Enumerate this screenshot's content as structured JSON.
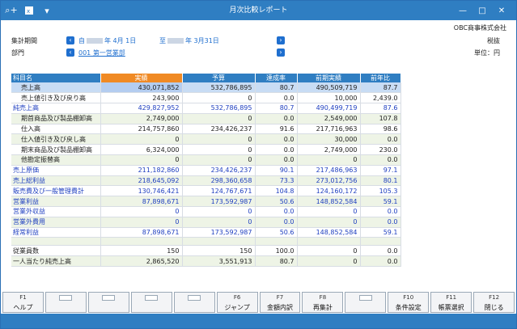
{
  "window": {
    "title": "月次比較レポート",
    "company": "OBC商事株式会社"
  },
  "head": {
    "period_label": "集計期間",
    "period_from_prefix": "自",
    "period_from_suffix": "年 4月 1日",
    "period_to_prefix": "至",
    "period_to_suffix": "年 3月31日",
    "dept_label": "部門",
    "dept_value": "001 第一営業部",
    "tax_label": "税抜",
    "unit_label": "単位：円"
  },
  "table": {
    "headers": [
      "科目名",
      "実績",
      "予算",
      "達成率",
      "前期実績",
      "前年比"
    ],
    "rows": [
      {
        "name": "売上高",
        "v": [
          "430,071,852",
          "532,786,895",
          "80.7",
          "490,509,719",
          "87.7"
        ],
        "indent": true,
        "style": "sel"
      },
      {
        "name": "売上値引き及び戻り高",
        "v": [
          "243,900",
          "0",
          "0.0",
          "10,000",
          "2,439.0"
        ],
        "indent": true,
        "style": ""
      },
      {
        "name": "純売上高",
        "v": [
          "429,827,952",
          "532,786,895",
          "80.7",
          "490,499,719",
          "87.6"
        ],
        "indent": false,
        "style": "blue"
      },
      {
        "name": "期首商品及び製品棚卸高",
        "v": [
          "2,749,000",
          "0",
          "0.0",
          "2,549,000",
          "107.8"
        ],
        "indent": true,
        "style": "alt"
      },
      {
        "name": "仕入高",
        "v": [
          "214,757,860",
          "234,426,237",
          "91.6",
          "217,716,963",
          "98.6"
        ],
        "indent": true,
        "style": ""
      },
      {
        "name": "仕入値引き及び戻し高",
        "v": [
          "0",
          "0",
          "0.0",
          "30,000",
          "0.0"
        ],
        "indent": true,
        "style": "alt"
      },
      {
        "name": "期末商品及び製品棚卸高",
        "v": [
          "6,324,000",
          "0",
          "0.0",
          "2,749,000",
          "230.0"
        ],
        "indent": true,
        "style": ""
      },
      {
        "name": "他勘定振替高",
        "v": [
          "0",
          "0",
          "0.0",
          "0",
          "0.0"
        ],
        "indent": true,
        "style": "alt"
      },
      {
        "name": "売上原価",
        "v": [
          "211,182,860",
          "234,426,237",
          "90.1",
          "217,486,963",
          "97.1"
        ],
        "indent": false,
        "style": "blue"
      },
      {
        "name": "売上総利益",
        "v": [
          "218,645,092",
          "298,360,658",
          "73.3",
          "273,012,756",
          "80.1"
        ],
        "indent": false,
        "style": "blue alt"
      },
      {
        "name": "販売費及び一般管理費計",
        "v": [
          "130,746,421",
          "124,767,671",
          "104.8",
          "124,160,172",
          "105.3"
        ],
        "indent": false,
        "style": "blue"
      },
      {
        "name": "営業利益",
        "v": [
          "87,898,671",
          "173,592,987",
          "50.6",
          "148,852,584",
          "59.1"
        ],
        "indent": false,
        "style": "blue alt"
      },
      {
        "name": "営業外収益",
        "v": [
          "0",
          "0",
          "0.0",
          "0",
          "0.0"
        ],
        "indent": false,
        "style": "blue"
      },
      {
        "name": "営業外費用",
        "v": [
          "0",
          "0",
          "0.0",
          "0",
          "0.0"
        ],
        "indent": false,
        "style": "blue alt"
      },
      {
        "name": "経常利益",
        "v": [
          "87,898,671",
          "173,592,987",
          "50.6",
          "148,852,584",
          "59.1"
        ],
        "indent": false,
        "style": "blue"
      },
      {
        "name": "",
        "v": [
          "",
          "",
          "",
          "",
          ""
        ],
        "indent": false,
        "style": "alt blank"
      },
      {
        "name": "従業員数",
        "v": [
          "150",
          "150",
          "100.0",
          "0",
          "0.0"
        ],
        "indent": false,
        "style": ""
      },
      {
        "name": "一人当たり純売上高",
        "v": [
          "2,865,520",
          "3,551,913",
          "80.7",
          "0",
          "0.0"
        ],
        "indent": false,
        "style": "alt"
      }
    ]
  },
  "fkeys": [
    {
      "num": "F1",
      "label": "ヘルプ"
    },
    {
      "num": "",
      "label": ""
    },
    {
      "num": "",
      "label": ""
    },
    {
      "num": "",
      "label": ""
    },
    {
      "num": "",
      "label": ""
    },
    {
      "num": "F6",
      "label": "ジャンプ"
    },
    {
      "num": "F7",
      "label": "金額内訳"
    },
    {
      "num": "F8",
      "label": "再集計"
    },
    {
      "num": "",
      "label": ""
    },
    {
      "num": "F10",
      "label": "条件設定"
    },
    {
      "num": "F11",
      "label": "帳票選択"
    },
    {
      "num": "F12",
      "label": "閉じる"
    }
  ],
  "colors": {
    "titlebar": "#2f7ec2",
    "header": "#2f7ec2",
    "highlight": "#f08a24",
    "link": "#1f6fcf"
  },
  "icons": [
    "search-plus-icon",
    "excel-icon",
    "dropdown-icon",
    "minimize-icon",
    "maximize-icon",
    "close-icon"
  ]
}
